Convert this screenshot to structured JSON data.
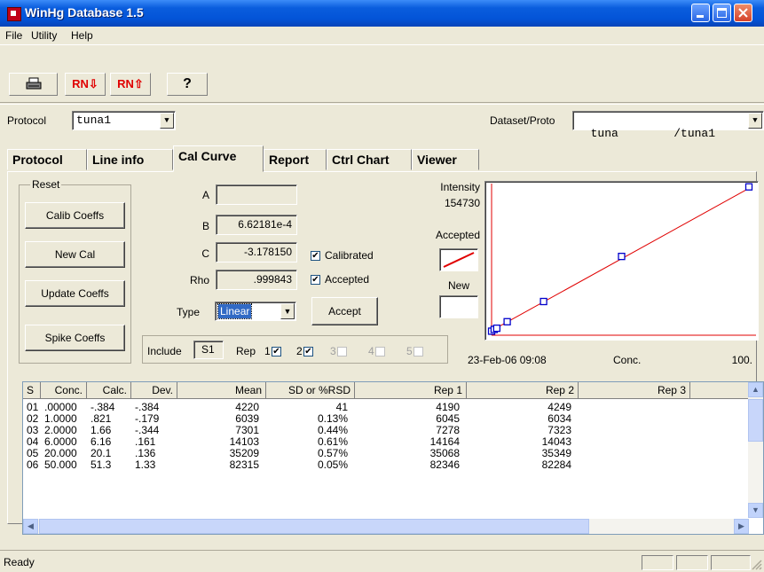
{
  "window": {
    "title": "WinHg Database 1.5"
  },
  "menu": [
    "File",
    "Utility",
    "Help"
  ],
  "toolbar": {
    "rn_down": "RN⇩",
    "rn_up": "RN⇧",
    "help": "?"
  },
  "protocol": {
    "label": "Protocol",
    "value": "tuna1"
  },
  "dataset": {
    "label": "Dataset/Proto",
    "value": "tuna        /tuna1"
  },
  "tabs": [
    "Protocol",
    "Line info",
    "Cal Curve",
    "Report",
    "Ctrl Chart",
    "Viewer"
  ],
  "reset": {
    "label": "Reset",
    "calib": "Calib Coeffs",
    "newcal": "New Cal",
    "update": "Update Coeffs",
    "spike": "Spike Coeffs"
  },
  "coeffs": {
    "a_label": "A",
    "a": "",
    "b_label": "B",
    "b": "6.62181e-4",
    "c_label": "C",
    "c": "-3.178150",
    "rho_label": "Rho",
    "rho": ".999843"
  },
  "checks": {
    "calibrated": "Calibrated",
    "accepted": "Accepted"
  },
  "type": {
    "label": "Type",
    "value": "Linear"
  },
  "accept_button": "Accept",
  "include": {
    "label": "Include",
    "value": "S1",
    "rep": "Rep",
    "reps": [
      "1",
      "2",
      "3",
      "4",
      "5"
    ]
  },
  "legend": {
    "intensity": "Intensity",
    "intensity_value": "154730",
    "accepted": "Accepted",
    "new": "New"
  },
  "chart_data": {
    "type": "scatter",
    "x_left_label": "23-Feb-06 09:08",
    "x_label": "Conc.",
    "x_max_label": "100.",
    "xlim": [
      0,
      100
    ],
    "ylim": [
      0,
      154730
    ],
    "points": [
      {
        "x": 0.0,
        "y": 4220
      },
      {
        "x": 1.0,
        "y": 6039
      },
      {
        "x": 2.0,
        "y": 7301
      },
      {
        "x": 6.0,
        "y": 14103
      },
      {
        "x": 20.0,
        "y": 35209
      },
      {
        "x": 50.0,
        "y": 82315
      },
      {
        "x": 100.0,
        "y": 155000
      }
    ],
    "fit_line": [
      {
        "x": 0,
        "y": 4800
      },
      {
        "x": 100,
        "y": 155000
      }
    ],
    "point_color": "#0000cc",
    "line_color": "#e00000"
  },
  "table": {
    "headers": [
      "S",
      "Conc.",
      "Calc.",
      "Dev.",
      "Mean",
      "SD or %RSD",
      "Rep 1",
      "Rep 2",
      "Rep 3"
    ],
    "rows": [
      [
        "01",
        ".00000",
        "-.384",
        "-.384",
        "4220",
        "41",
        "4190",
        "4249",
        ""
      ],
      [
        "02",
        "1.0000",
        ".821",
        "-.179",
        "6039",
        "0.13%",
        "6045",
        "6034",
        ""
      ],
      [
        "03",
        "2.0000",
        "1.66",
        "-.344",
        "7301",
        "0.44%",
        "7278",
        "7323",
        ""
      ],
      [
        "04",
        "6.0000",
        "6.16",
        ".161",
        "14103",
        "0.61%",
        "14164",
        "14043",
        ""
      ],
      [
        "05",
        "20.000",
        "20.1",
        ".136",
        "35209",
        "0.57%",
        "35068",
        "35349",
        ""
      ],
      [
        "06",
        "50.000",
        "51.3",
        "1.33",
        "82315",
        "0.05%",
        "82346",
        "82284",
        ""
      ]
    ]
  },
  "status": {
    "text": "Ready"
  }
}
